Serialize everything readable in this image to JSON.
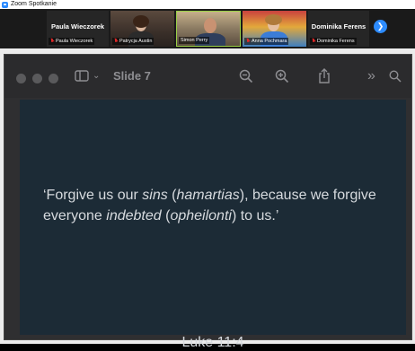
{
  "window": {
    "title": "Zoom Spotkanie",
    "icon": "zoom-logo-icon"
  },
  "participants": [
    {
      "display": "Paula Wieczorek",
      "label": "Paula Wieczorek",
      "video": false,
      "muted": true
    },
    {
      "display": "",
      "label": "Patrycja Austin",
      "video": true,
      "muted": true
    },
    {
      "display": "",
      "label": "Simon Perry",
      "video": true,
      "muted": false,
      "active": true
    },
    {
      "display": "",
      "label": "Anna Pochmara",
      "video": true,
      "muted": true
    },
    {
      "display": "Dominika Ferens",
      "label": "Dominika Ferens",
      "video": false,
      "muted": true
    }
  ],
  "gallery_next_icon": "chevron-right-icon",
  "keynote": {
    "slide_title": "Slide 7",
    "toolbar_icons": [
      "sidebar-icon",
      "chevron-down-icon",
      "zoom-out-icon",
      "zoom-in-icon",
      "share-icon",
      "more-chevrons-icon",
      "search-icon"
    ]
  },
  "slide": {
    "quote_parts": [
      "‘Forgive us our ",
      "sins",
      " (",
      "hamartias",
      "), because we forgive everyone ",
      "indebted",
      " (",
      "opheilonti",
      ") to us.’"
    ],
    "reference": "Luke 11:4"
  },
  "colors": {
    "zoom_blue": "#2D8CFF",
    "active_speaker": "#9ad045",
    "slide_bg": "#1c2b36"
  }
}
